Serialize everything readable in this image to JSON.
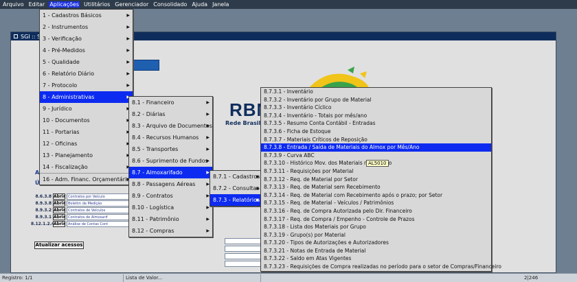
{
  "menubar": {
    "items": [
      "Arquivo",
      "Editar",
      "Aplicações",
      "Utilitários",
      "Gerenciador",
      "Consolidado",
      "Ajuda",
      "Janela"
    ],
    "active_index": 2
  },
  "window": {
    "title": "SGI :: S"
  },
  "logo": {
    "text": "RBN",
    "subtitle": "Rede Brasilei"
  },
  "side_labels": {
    "ac": "Ac",
    "ul": "Úl"
  },
  "accesses": [
    {
      "code": "8.6.3.8",
      "button": "Abrir",
      "desc": "Contratos por Veículo"
    },
    {
      "code": "8.9.3.8",
      "button": "Abrir",
      "desc": "Boletim de Medição"
    },
    {
      "code": "8.9.3.2",
      "button": "Abrir",
      "desc": "Contratos de Veículos"
    },
    {
      "code": "8.9.3.1",
      "button": "Abrir",
      "desc": "Contratos de Almoxarif"
    },
    {
      "code": "8.12.1.2.4",
      "button": "Abrir",
      "desc": "Análise de Contas Cont"
    }
  ],
  "update_button": "Atualizar acessos",
  "statusbar": {
    "record": "Registro: 1/1",
    "lov": "Lista de Valor...",
    "right_code": "2|246"
  },
  "menu_level1": {
    "items": [
      {
        "label": "1 - Cadastros Básicos",
        "arrow": true
      },
      {
        "label": "2 - Instrumentos",
        "arrow": true
      },
      {
        "label": "3 - Verificação",
        "arrow": true
      },
      {
        "label": "4 - Pré-Medidos",
        "arrow": true
      },
      {
        "label": "5 - Qualidade",
        "arrow": true
      },
      {
        "label": "6 - Relatório Diário",
        "arrow": true
      },
      {
        "label": "7 - Protocolo",
        "arrow": true
      },
      {
        "label": "8 - Administrativas",
        "arrow": true
      },
      {
        "label": "9 - Jurídico",
        "arrow": true
      },
      {
        "label": "10 - Documentos",
        "arrow": true
      },
      {
        "label": "11 - Portarias",
        "arrow": true
      },
      {
        "label": "12 - Oficinas",
        "arrow": true
      },
      {
        "label": "13 - Planejamento",
        "arrow": true
      },
      {
        "label": "14 - Fiscalização",
        "arrow": true
      },
      {
        "label": "16 - Adm. Financ. Orçamentária",
        "arrow": true
      }
    ],
    "highlight_index": 7
  },
  "menu_level2": {
    "items": [
      {
        "label": "8.1 - Financeiro",
        "arrow": true
      },
      {
        "label": "8.2 - Diárias",
        "arrow": true
      },
      {
        "label": "8.3 - Arquivo de Documentos",
        "arrow": true
      },
      {
        "label": "8.4 - Recursos Humanos",
        "arrow": true
      },
      {
        "label": "8.5 - Transportes",
        "arrow": true
      },
      {
        "label": "8.6 - Suprimento de Fundos",
        "arrow": true
      },
      {
        "label": "8.7 - Almoxarifado",
        "arrow": true
      },
      {
        "label": "8.8 - Passagens Aéreas",
        "arrow": true
      },
      {
        "label": "8.9 - Contratos",
        "arrow": true
      },
      {
        "label": "8.10 - Logística",
        "arrow": true
      },
      {
        "label": "8.11 - Patrimônio",
        "arrow": true
      },
      {
        "label": "8.12 - Compras",
        "arrow": true
      }
    ],
    "highlight_index": 6
  },
  "menu_level3": {
    "items": [
      {
        "label": "8.7.1 - Cadastros",
        "arrow": true
      },
      {
        "label": "8.7.2 - Consultas",
        "arrow": true
      },
      {
        "label": "8.7.3 - Relatórios",
        "arrow": true
      }
    ],
    "highlight_index": 2
  },
  "menu_level4": {
    "items": [
      {
        "label": "8.7.3.1 - Inventário"
      },
      {
        "label": "8.7.3.2 - Inventário por Grupo de Material"
      },
      {
        "label": "8.7.3.3 - Inventário Cíclico"
      },
      {
        "label": "8.7.3.4 - Inventário - Totais por mês/ano"
      },
      {
        "label": "8.7.3.5 - Resumo Conta Contábil - Entradas"
      },
      {
        "label": "8.7.3.6 - Ficha de Estoque"
      },
      {
        "label": "8.7.3.7 - Materiais Críticos de Reposição"
      },
      {
        "label": "8.7.3.8 - Entrada / Saída de Materiais do Almox por Mês/Ano"
      },
      {
        "label": "8.7.3.9 - Curva ABC"
      },
      {
        "label": "8.7.3.10 - Histórico Mov. dos Materiais no período"
      },
      {
        "label": "8.7.3.11 - Requisições por Material"
      },
      {
        "label": "8.7.3.12 - Req. de Material por Setor"
      },
      {
        "label": "8.7.3.13 - Req. de Material sem Recebimento"
      },
      {
        "label": "8.7.3.14 - Req. de Material com Recebimento após o prazo; por Setor"
      },
      {
        "label": "8.7.3.15 - Req. de Material - Veículos / Patrimônios"
      },
      {
        "label": "8.7.3.16 - Req. de Compra Autorizada pelo Dir. Financeiro"
      },
      {
        "label": "8.7.3.17 - Req. de Compra / Empenho - Controle de Prazos"
      },
      {
        "label": "8.7.3.18 - Lista dos Materiais por Grupo"
      },
      {
        "label": "8.7.3.19 - Grupo(s) por Material"
      },
      {
        "label": "8.7.3.20 - Tipos de Autorizações e Autorizadores"
      },
      {
        "label": "8.7.3.21 - Notas de Entrada de Material"
      },
      {
        "label": "8.7.3.22 - Saldo em Atas Vigentes"
      },
      {
        "label": "8.7.3.23 - Requisições de Compra realizadas no período para o setor de Compras/Financeiro"
      }
    ],
    "highlight_index": 7
  },
  "tooltip": "AL5010",
  "colors": {
    "highlight": "#0d2bf0",
    "menubar": "#2e3b4a",
    "window_title": "#0e2d5c"
  }
}
